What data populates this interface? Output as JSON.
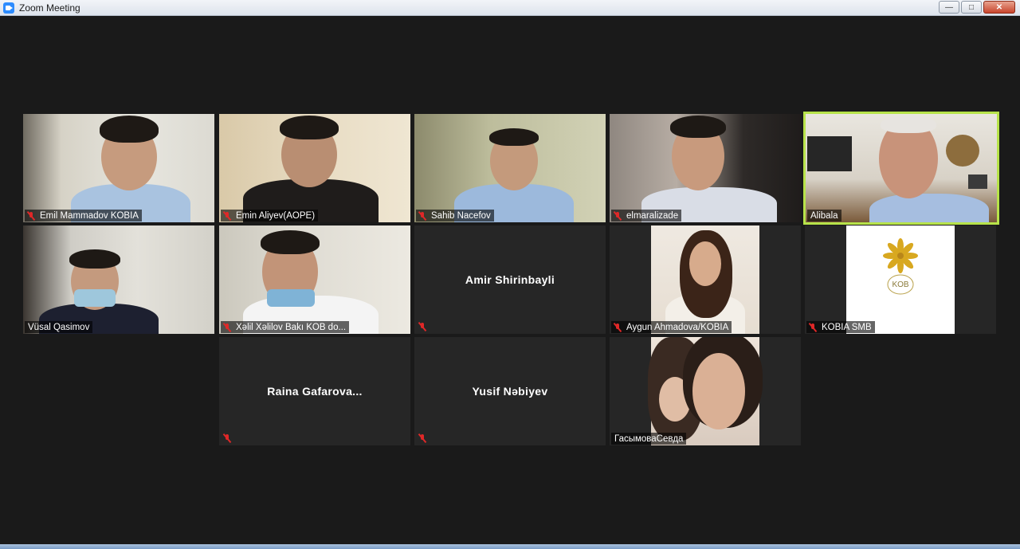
{
  "window": {
    "title": "Zoom Meeting",
    "controls": [
      "minimize",
      "maximize",
      "close"
    ]
  },
  "colors": {
    "background": "#1a1a1a",
    "active_speaker_border": "#b7e34a",
    "muted_icon": "#e02828"
  },
  "participants": [
    {
      "name": "Emil Mammadov KOBIA",
      "video": true,
      "muted": true
    },
    {
      "name": "Emin Aliyev(AOPE)",
      "video": true,
      "muted": true
    },
    {
      "name": "Sahib Nacefov",
      "video": true,
      "muted": true
    },
    {
      "name": "elmaralizade",
      "video": true,
      "muted": true
    },
    {
      "name": "Alibala",
      "video": true,
      "muted": false,
      "active_speaker": true
    },
    {
      "name": "Vüsal Qasimov",
      "video": true,
      "muted": false
    },
    {
      "name": "Xəlil Xəlilov Bakı KOB do...",
      "video": true,
      "muted": true
    },
    {
      "name": "Amir Shirinbayli",
      "video": false,
      "muted": true
    },
    {
      "name": "Aygun Ahmadova/KOBIA",
      "video": true,
      "muted": true
    },
    {
      "name": "KOBIA SMB",
      "video": true,
      "muted": true
    },
    {
      "name": "Raina Gafarova...",
      "video": false,
      "muted": true
    },
    {
      "name": "Yusif Nəbiyev",
      "video": false,
      "muted": true
    },
    {
      "name": "ГасымоваСевда",
      "video": true,
      "muted": false
    }
  ]
}
